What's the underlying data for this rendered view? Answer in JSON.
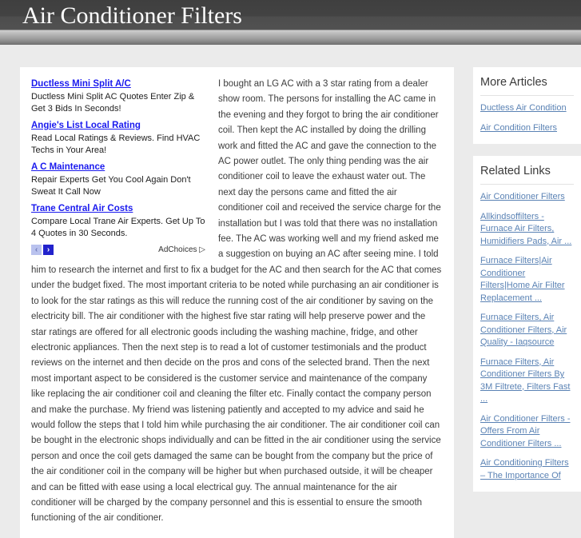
{
  "header": {
    "site_title": "Air Conditioner Filters"
  },
  "ads": {
    "units": [
      {
        "title": "Ductless Mini Split A/C",
        "desc": "Ductless Mini Split AC Quotes Enter Zip & Get 3 Bids In Seconds!"
      },
      {
        "title": "Angie's List Local Rating",
        "desc": "Read Local Ratings & Reviews. Find HVAC Techs in Your Area!"
      },
      {
        "title": "A C Maintenance",
        "desc": "Repair Experts Get You Cool Again Don't Sweat It Call Now"
      },
      {
        "title": "Trane Central Air Costs",
        "desc": "Compare Local Trane Air Experts. Get Up To 4 Quotes in 30 Seconds."
      }
    ],
    "prev_arrow": "‹",
    "next_arrow": "›",
    "adchoices_label": "AdChoices",
    "adchoices_glyph": "▷",
    "link_color": "#1a1aee",
    "next_bg": "#2222cc",
    "prev_bg": "#b9c2ee"
  },
  "article": {
    "text": "I bought an LG AC with a 3 star rating from a dealer show room. The persons for installing the AC came in the evening and they forgot to bring the air conditioner coil. Then kept the AC installed by doing the drilling work and fitted the AC and gave the connection to the AC power outlet. The only thing pending was the air conditioner coil to leave the exhaust water out. The next day the persons came and fitted the air conditioner coil and received the service charge for the installation but I was told that there was no installation fee. The AC was working well and my friend asked me a suggestion on buying an AC after seeing mine. I told him to research the internet and first to fix a budget for the AC and then search for the AC that comes under the budget fixed. The most important criteria to be noted while purchasing an air conditioner is to look for the star ratings as this will reduce the running cost of the air conditioner by saving on the electricity bill. The air conditioner with the highest five star rating will help preserve power and the star ratings are offered for all electronic goods including the washing machine, fridge, and other electronic appliances. Then the next step is to read a lot of customer testimonials and the product reviews on the internet and then decide on the pros and cons of the selected brand. Then the next most important aspect to be considered is the customer service and maintenance of the company like replacing the air conditioner coil and cleaning the filter etc. Finally contact the company person and make the purchase. My friend was listening patiently and accepted to my advice and said he would follow the steps that I told him while purchasing the air conditioner. The air conditioner coil can be bought in the electronic shops individually and can be fitted in the air conditioner using the service person and once the coil gets damaged the same can be bought from the company but the price of the air conditioner coil in the company will be higher but when purchased outside, it will be cheaper and can be fitted with ease using a local electrical guy. The annual maintenance for the air conditioner will be charged by the company personnel and this is essential to ensure the smooth functioning of the air conditioner."
  },
  "sidebar": {
    "more_articles": {
      "heading": "More Articles",
      "links": [
        "Ductless Air Condition",
        "Air Condition Filters"
      ]
    },
    "related_links": {
      "heading": "Related Links",
      "links": [
        "Air Conditioner Filters",
        "Allkindsoffilters - Furnace Air Filters, Humidifiers Pads, Air ...",
        "Furnace Filters|Air Conditioner Filters|Home Air Filter Replacement ...",
        "Furnace Filters, Air Conditioner Filters, Air Quality - Iaqsource",
        "Furnace Filters, Air Conditioner Filters By 3M Filtrete, Filters Fast ...",
        "Air Conditioner Filters - Offers From Air Conditioner Filters ...",
        "Air Conditioning Filters – The Importance Of"
      ],
      "link_color": "#5a82b4"
    }
  }
}
